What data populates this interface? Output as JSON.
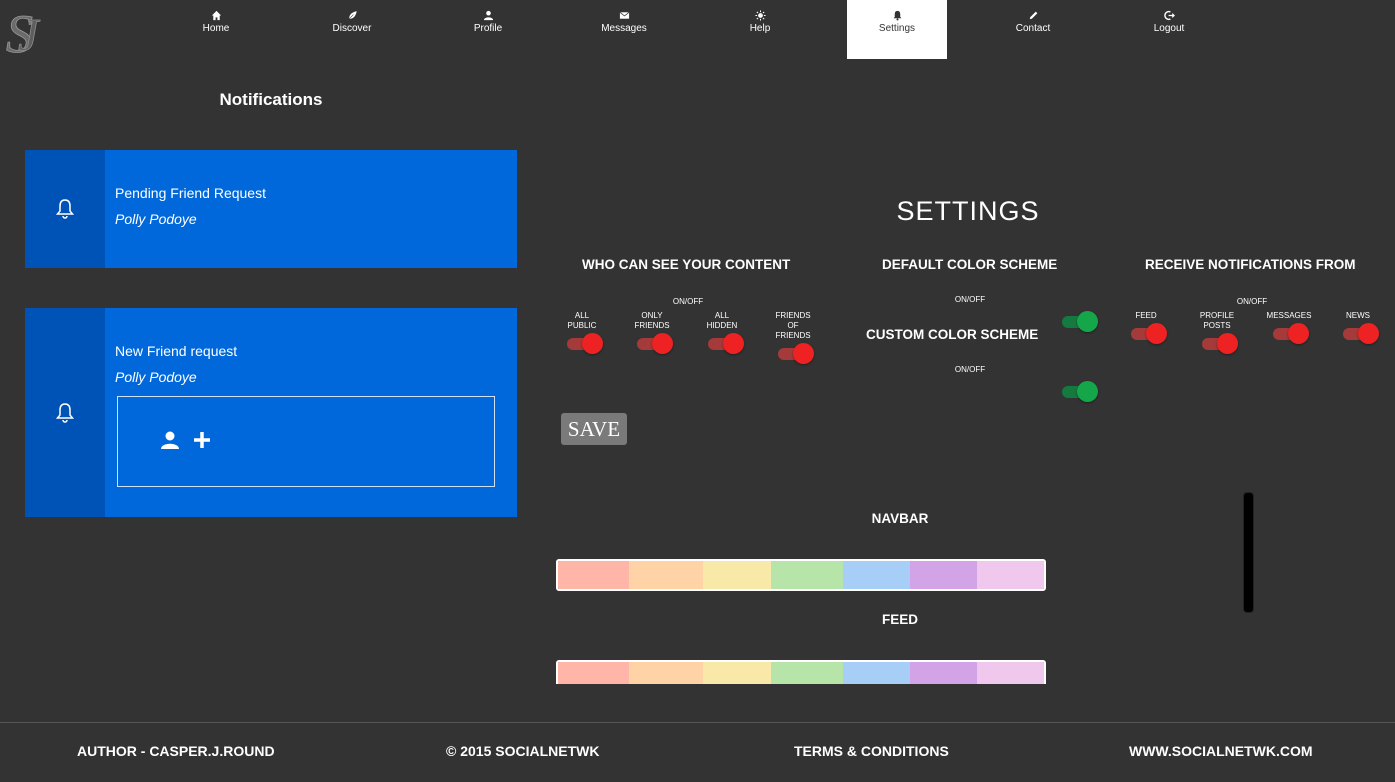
{
  "colors": {
    "background": "#333333",
    "card_blue": "#0068db",
    "card_side": "#0053b6",
    "toggle_red": "#ee2222",
    "toggle_green": "#16a64a",
    "active_nav_bg": "#ffffff"
  },
  "nav": {
    "items": [
      {
        "label": "Home",
        "icon": "home-icon"
      },
      {
        "label": "Discover",
        "icon": "leaf-icon"
      },
      {
        "label": "Profile",
        "icon": "user-icon"
      },
      {
        "label": "Messages",
        "icon": "envelope-icon"
      },
      {
        "label": "Help",
        "icon": "sun-icon"
      },
      {
        "label": "Settings",
        "icon": "bell-icon",
        "active": true
      },
      {
        "label": "Contact",
        "icon": "pencil-icon"
      },
      {
        "label": "Logout",
        "icon": "logout-icon"
      }
    ]
  },
  "notifications": {
    "title": "Notifications",
    "items": [
      {
        "title": "Pending Friend Request",
        "name": "Polly Podoye",
        "icon": "bell-icon"
      },
      {
        "title": "New Friend request",
        "name": "Polly Podoye",
        "icon": "bell-icon",
        "actions": [
          "add-user-icon",
          "plus-icon"
        ]
      }
    ]
  },
  "settings": {
    "title": "SETTINGS",
    "visibility": {
      "heading": "WHO CAN SEE YOUR CONTENT",
      "onoff": "ON/OFF",
      "options": [
        {
          "label1": "ALL",
          "label2": "PUBLIC",
          "label3": "",
          "state": "on"
        },
        {
          "label1": "ONLY",
          "label2": "FRIENDS",
          "label3": "",
          "state": "on"
        },
        {
          "label1": "ALL",
          "label2": "HIDDEN",
          "label3": "",
          "state": "on"
        },
        {
          "label1": "FRIENDS",
          "label2": "OF",
          "label3": "FRIENDS",
          "state": "on"
        }
      ]
    },
    "default_scheme": {
      "heading": "DEFAULT COLOR SCHEME",
      "onoff": "ON/OFF",
      "state": "on"
    },
    "custom_scheme": {
      "heading": "CUSTOM COLOR SCHEME",
      "onoff": "ON/OFF",
      "state": "on"
    },
    "receive": {
      "heading": "RECEIVE NOTIFICATIONS FROM",
      "onoff": "ON/OFF",
      "options": [
        {
          "label1": "FEED",
          "label2": "",
          "state": "on"
        },
        {
          "label1": "PROFILE",
          "label2": "POSTS",
          "state": "on"
        },
        {
          "label1": "MESSAGES",
          "label2": "",
          "state": "on"
        },
        {
          "label1": "NEWS",
          "label2": "",
          "state": "on"
        }
      ]
    },
    "save_label": "SAVE",
    "palettes": [
      {
        "title": "NAVBAR",
        "colors": [
          "#ffb5a7",
          "#ffd3a5",
          "#f9e9a8",
          "#b7e4a8",
          "#a7cef7",
          "#d3a3e8",
          "#f0c8ee"
        ]
      },
      {
        "title": "FEED",
        "colors": [
          "#ffb5a7",
          "#ffd3a5",
          "#f9e9a8",
          "#b7e4a8",
          "#a7cef7",
          "#d3a3e8",
          "#f0c8ee"
        ]
      }
    ]
  },
  "footer": {
    "author": "AUTHOR - CASPER.J.ROUND",
    "copyright": "© 2015 SOCIALNETWK",
    "terms": "TERMS & CONDITIONS",
    "website": "WWW.SOCIALNETWK.COM"
  }
}
